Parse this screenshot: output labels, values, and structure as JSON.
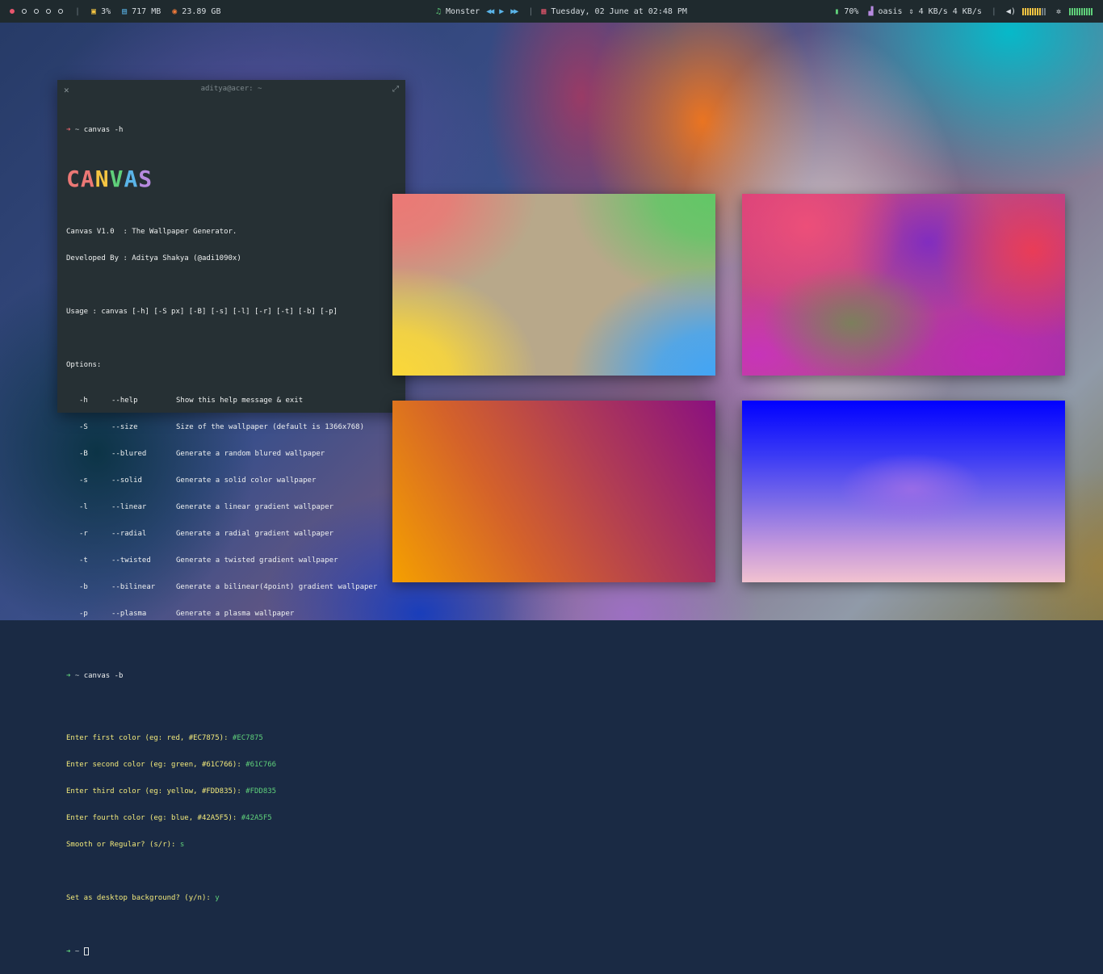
{
  "topbar": {
    "workspaces": 5,
    "cpu": "3%",
    "memory": "717 MB",
    "disk": "23.89 GB",
    "music_track": "Monster",
    "date": "Tuesday, 02 June at 02:48 PM",
    "battery": "70%",
    "network_name": "oasis",
    "net_speed": "4 KB/s 4 KB/s",
    "icons": {
      "cpu": "cpu-icon",
      "memory": "memory-icon",
      "disk": "disk-icon",
      "music": "music-note-icon",
      "calendar": "calendar-icon",
      "battery": "battery-icon",
      "wifi": "wifi-icon",
      "transfer": "transfer-icon",
      "volume": "volume-icon",
      "brightness": "brightness-icon"
    },
    "colors": {
      "active_workspace": "#e8566d",
      "accent_yellow": "#f5c542",
      "accent_green": "#5fd07a",
      "accent_red": "#e8666d",
      "accent_blue": "#5ab4e8"
    }
  },
  "terminal": {
    "title": "aditya@acer: ~",
    "prompt_symbol": "➜",
    "prompt_dir": "~",
    "command1": "canvas -h",
    "logo_letters": [
      "C",
      "A",
      "N",
      "V",
      "A",
      "S"
    ],
    "logo_colors": [
      "#ec7875",
      "#ec7875",
      "#f5c542",
      "#5fd07a",
      "#5ab4e8",
      "#b78ae0"
    ],
    "intro1": "Canvas V1.0  : The Wallpaper Generator.",
    "intro2": "Developed By : Aditya Shakya (@adi1090x)",
    "usage": "Usage : canvas [-h] [-S px] [-B] [-s] [-l] [-r] [-t] [-b] [-p]",
    "options_label": "Options:",
    "options": [
      {
        "short": "-h",
        "long": "--help",
        "desc": "Show this help message & exit"
      },
      {
        "short": "-S",
        "long": "--size",
        "desc": "Size of the wallpaper (default is 1366x768)"
      },
      {
        "short": "-B",
        "long": "--blured",
        "desc": "Generate a random blured wallpaper"
      },
      {
        "short": "-s",
        "long": "--solid",
        "desc": "Generate a solid color wallpaper"
      },
      {
        "short": "-l",
        "long": "--linear",
        "desc": "Generate a linear gradient wallpaper"
      },
      {
        "short": "-r",
        "long": "--radial",
        "desc": "Generate a radial gradient wallpaper"
      },
      {
        "short": "-t",
        "long": "--twisted",
        "desc": "Generate a twisted gradient wallpaper"
      },
      {
        "short": "-b",
        "long": "--bilinear",
        "desc": "Generate a bilinear(4point) gradient wallpaper"
      },
      {
        "short": "-p",
        "long": "--plasma",
        "desc": "Generate a plasma wallpaper"
      }
    ],
    "command2": "canvas -b",
    "prompts": [
      {
        "q": "Enter first color (eg: red, #EC7875): ",
        "a": "#EC7875"
      },
      {
        "q": "Enter second color (eg: green, #61C766): ",
        "a": "#61C766"
      },
      {
        "q": "Enter third color (eg: yellow, #FDD835): ",
        "a": "#FDD835"
      },
      {
        "q": "Enter fourth color (eg: blue, #42A5F5): ",
        "a": "#42A5F5"
      },
      {
        "q": "Smooth or Regular? (s/r): ",
        "a": "s"
      }
    ],
    "set_bg": {
      "q": "Set as desktop background? (y/n): ",
      "a": "y"
    }
  }
}
